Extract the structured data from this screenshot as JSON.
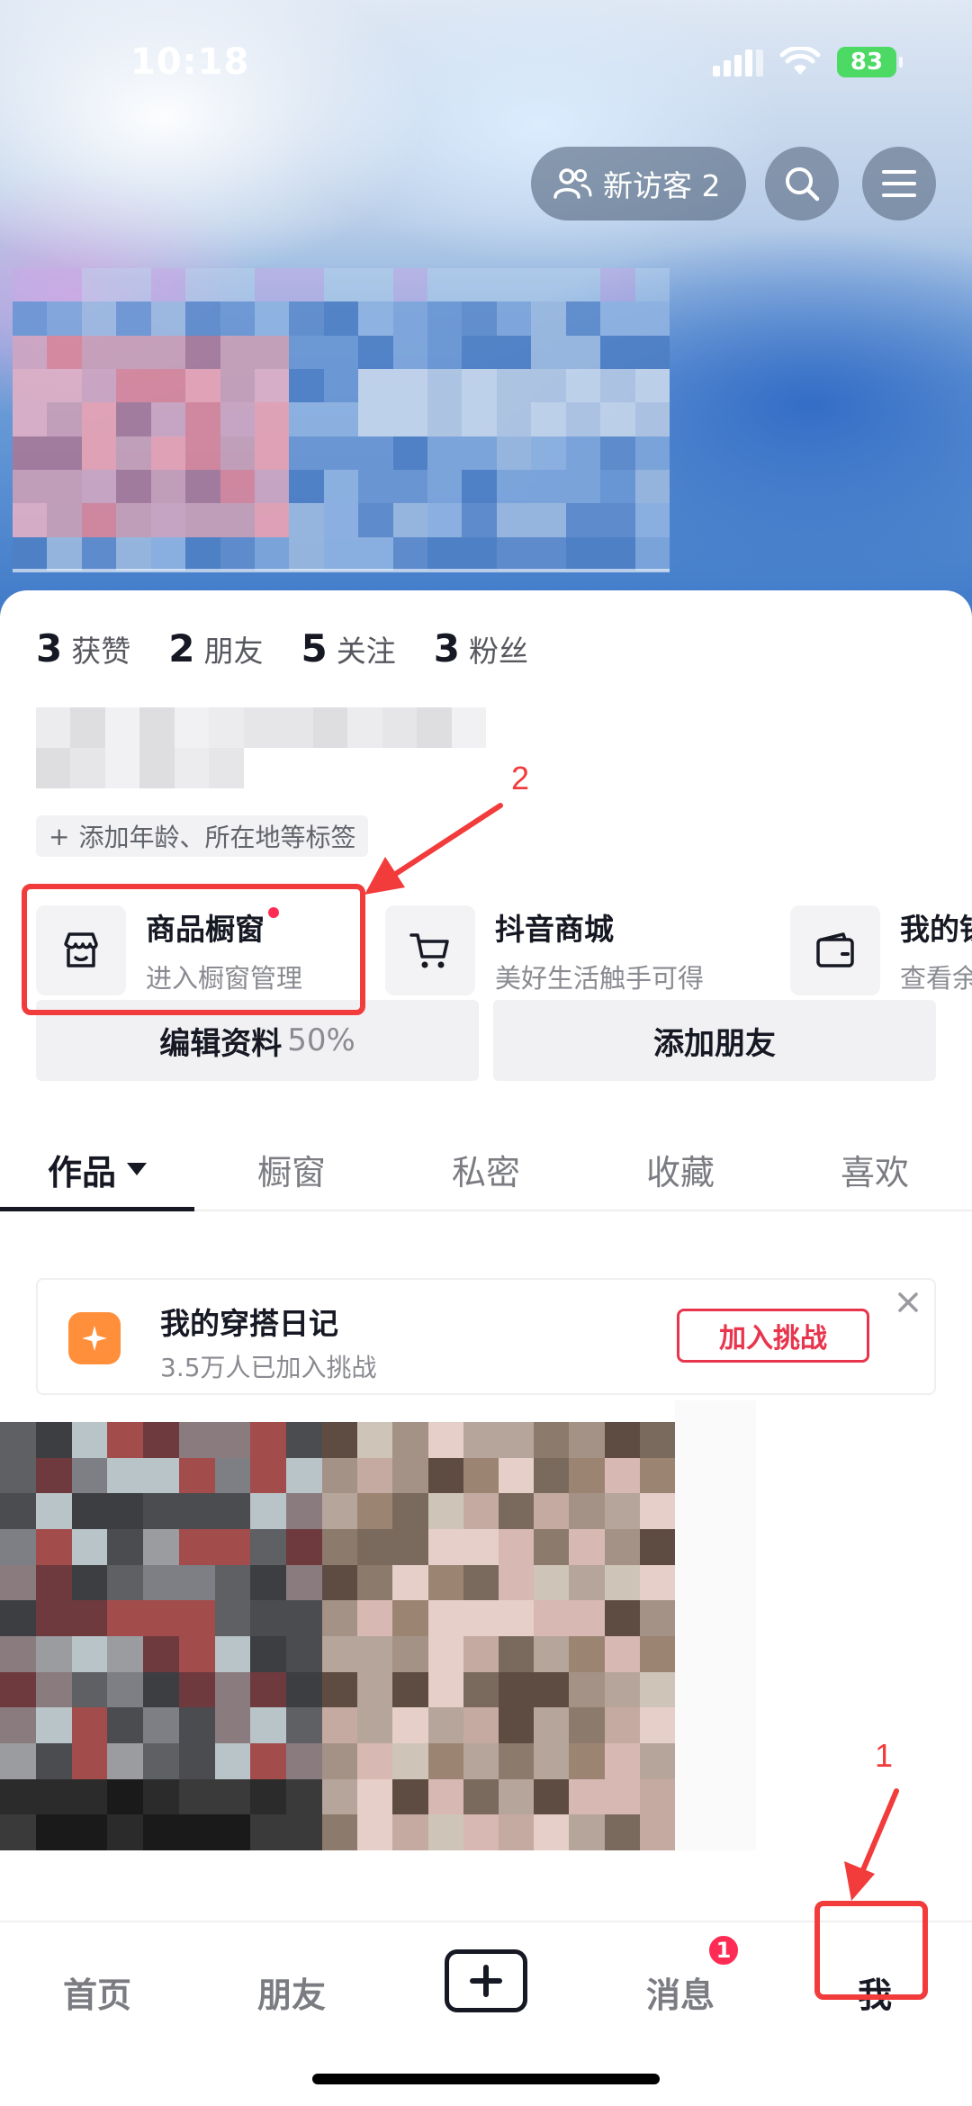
{
  "status_bar": {
    "time": "10:18",
    "battery": "83"
  },
  "header": {
    "visitor_label": "新访客 2",
    "icons": [
      "visitors-icon",
      "search-icon",
      "menu-icon"
    ]
  },
  "stats": [
    {
      "num": "3",
      "label": "获赞"
    },
    {
      "num": "2",
      "label": "朋友"
    },
    {
      "num": "5",
      "label": "关注"
    },
    {
      "num": "3",
      "label": "粉丝"
    }
  ],
  "tag_chip": {
    "plus": "+",
    "label": "添加年龄、所在地等标签"
  },
  "cards": [
    {
      "title": "商品橱窗",
      "sub": "进入橱窗管理",
      "icon": "storefront-icon"
    },
    {
      "title": "抖音商城",
      "sub": "美好生活触手可得",
      "icon": "cart-icon"
    },
    {
      "title": "我的钱包",
      "sub": "查看余额",
      "icon": "wallet-icon"
    }
  ],
  "buttons": {
    "edit_label": "编辑资料",
    "edit_percent": "50%",
    "add_friend": "添加朋友"
  },
  "tabs": [
    "作品",
    "橱窗",
    "私密",
    "收藏",
    "喜欢"
  ],
  "challenge": {
    "title": "我的穿搭日记",
    "sub": "3.5万人已加入挑战",
    "join": "加入挑战"
  },
  "bottom_nav": {
    "home": "首页",
    "friends": "朋友",
    "messages": "消息",
    "me": "我",
    "badge": "1"
  },
  "annotations": {
    "one": "1",
    "two": "2"
  },
  "colors": {
    "accent_red": "#fe2c55",
    "annotation_red": "#f23b3b",
    "challenge_orange": "#ff8f3a"
  }
}
